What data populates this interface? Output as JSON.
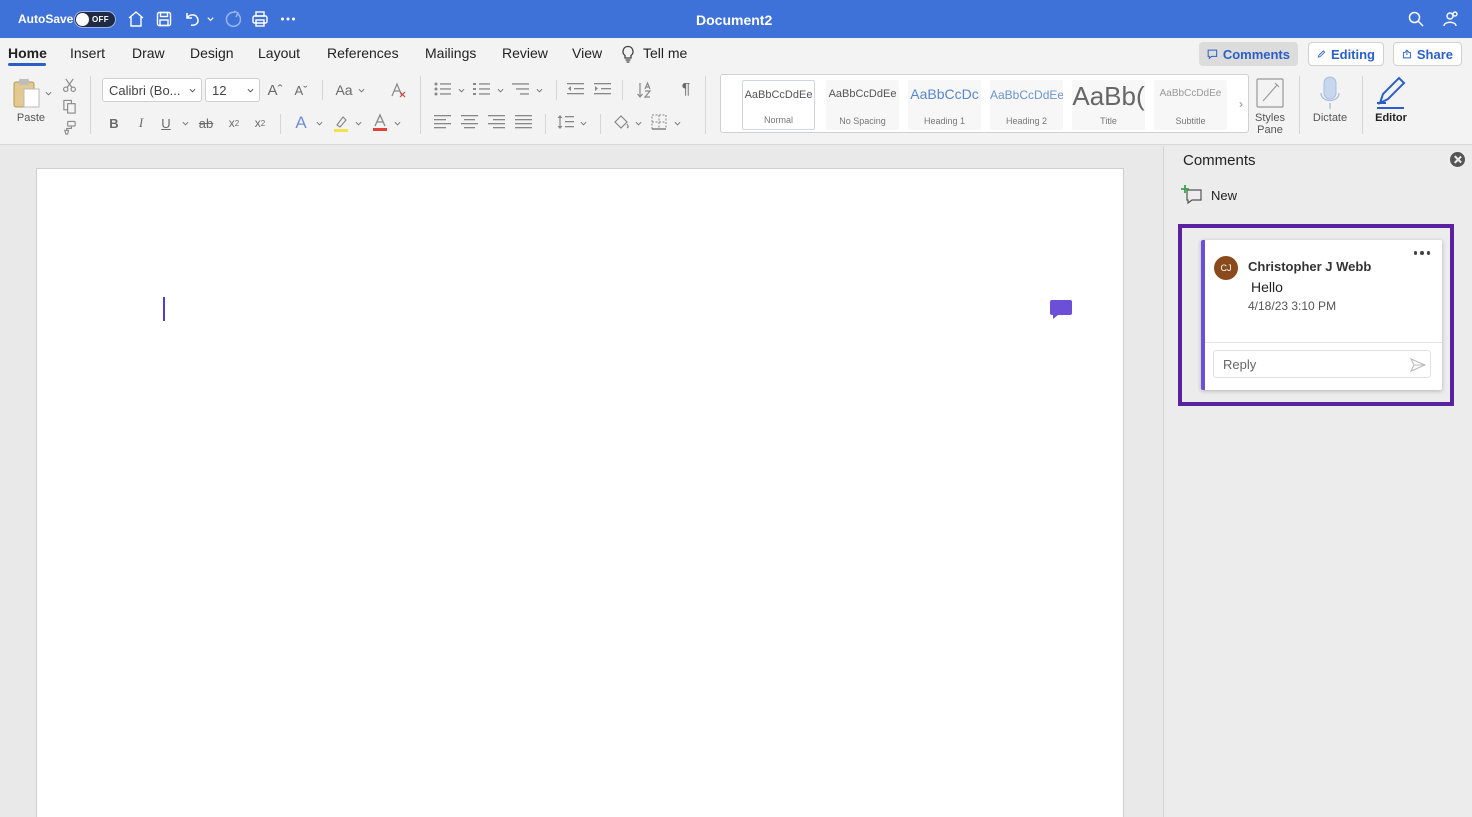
{
  "titlebar": {
    "autosave_label": "AutoSave",
    "autosave_state": "OFF",
    "document_title": "Document2",
    "icons": [
      "home-icon",
      "save-icon",
      "undo-icon",
      "redo-icon",
      "print-icon",
      "more-icon",
      "search-icon",
      "account-icon"
    ]
  },
  "tabs": {
    "items": [
      "Home",
      "Insert",
      "Draw",
      "Design",
      "Layout",
      "References",
      "Mailings",
      "Review",
      "View"
    ],
    "active": "Home",
    "tell_me": "Tell me"
  },
  "top_actions": {
    "comments": "Comments",
    "editing": "Editing",
    "share": "Share"
  },
  "ribbon": {
    "paste_label": "Paste",
    "font_name": "Calibri (Bo...",
    "font_size": "12",
    "styles": [
      {
        "sample": "AaBbCcDdEe",
        "name": "Normal"
      },
      {
        "sample": "AaBbCcDdEe",
        "name": "No Spacing"
      },
      {
        "sample": "AaBbCcDc",
        "name": "Heading 1"
      },
      {
        "sample": "AaBbCcDdEe",
        "name": "Heading 2"
      },
      {
        "sample": "AaBb(",
        "name": "Title"
      },
      {
        "sample": "AaBbCcDdEe",
        "name": "Subtitle"
      }
    ],
    "styles_pane_label": "Styles Pane",
    "dictate_label": "Dictate",
    "editor_label": "Editor",
    "font_color": "#e0413a",
    "highlight_color": "#f4e04d"
  },
  "comments_pane": {
    "title": "Comments",
    "new_label": "New",
    "comment": {
      "avatar_initials": "CJ",
      "author": "Christopher J Webb",
      "text": "Hello",
      "date": "4/18/23 3:10 PM",
      "reply_placeholder": "Reply"
    }
  },
  "colors": {
    "titlebar": "#3f72d8",
    "accent": "#2b5fc7",
    "highlight_box": "#5a22a0",
    "comment_accent": "#6b4fd6",
    "avatar": "#8a4a1c"
  }
}
